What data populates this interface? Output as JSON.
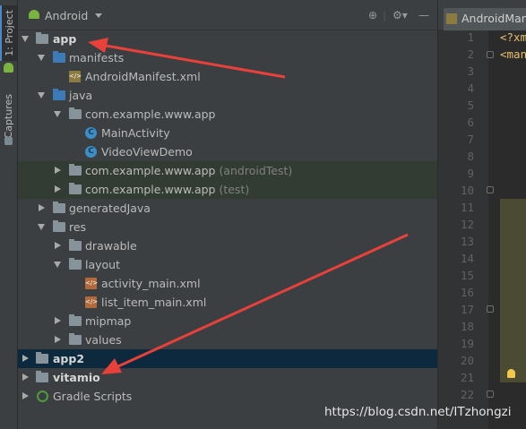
{
  "side_tabs": {
    "project": "1: Project",
    "captures": "Captures"
  },
  "header": {
    "view_mode": "Android"
  },
  "tree": [
    {
      "label": "app",
      "bold": true
    },
    {
      "label": "manifests"
    },
    {
      "label": "AndroidManifest.xml"
    },
    {
      "label": "java"
    },
    {
      "label": "com.example.www.app"
    },
    {
      "label": "MainActivity"
    },
    {
      "label": "VideoViewDemo"
    },
    {
      "label": "com.example.www.app",
      "suffix": "(androidTest)"
    },
    {
      "label": "com.example.www.app",
      "suffix": "(test)"
    },
    {
      "label": "generatedJava"
    },
    {
      "label": "res"
    },
    {
      "label": "drawable"
    },
    {
      "label": "layout"
    },
    {
      "label": "activity_main.xml"
    },
    {
      "label": "list_item_main.xml"
    },
    {
      "label": "mipmap"
    },
    {
      "label": "values"
    },
    {
      "label": "app2",
      "bold": true
    },
    {
      "label": "vitamio",
      "bold": true
    },
    {
      "label": "Gradle Scripts"
    }
  ],
  "editor": {
    "tab_label": "AndroidMani",
    "line_numbers": [
      "1",
      "2",
      "3",
      "4",
      "5",
      "6",
      "7",
      "8",
      "9",
      "10",
      "11",
      "12",
      "13",
      "14",
      "15",
      "16",
      "17",
      "18",
      "19",
      "20",
      "21",
      "22"
    ],
    "code_line_1": "<?xm",
    "code_line_2": "<man"
  },
  "watermark": "https://blog.csdn.net/ITzhongzi",
  "colors": {
    "accent": "#4a88c7",
    "annotation_arrow": "#e8403b",
    "selection": "#0d293e",
    "test_bg": "#333c33"
  }
}
